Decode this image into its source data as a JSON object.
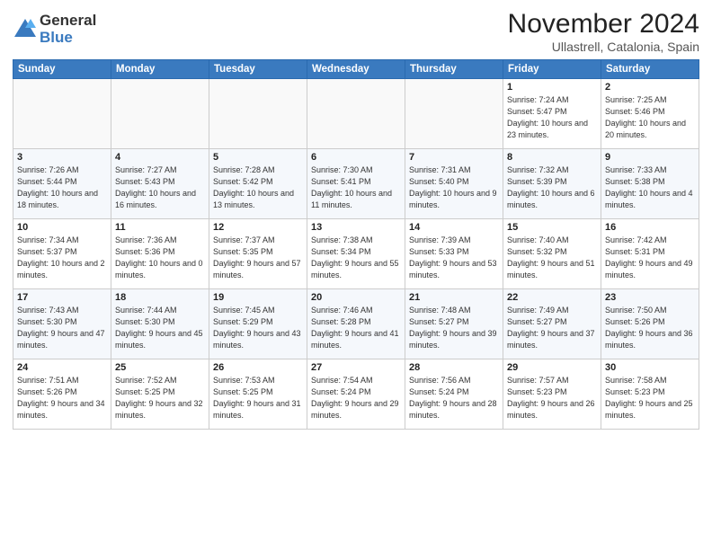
{
  "logo": {
    "general": "General",
    "blue": "Blue"
  },
  "title": "November 2024",
  "location": "Ullastrell, Catalonia, Spain",
  "weekdays": [
    "Sunday",
    "Monday",
    "Tuesday",
    "Wednesday",
    "Thursday",
    "Friday",
    "Saturday"
  ],
  "weeks": [
    [
      {
        "day": "",
        "info": ""
      },
      {
        "day": "",
        "info": ""
      },
      {
        "day": "",
        "info": ""
      },
      {
        "day": "",
        "info": ""
      },
      {
        "day": "",
        "info": ""
      },
      {
        "day": "1",
        "info": "Sunrise: 7:24 AM\nSunset: 5:47 PM\nDaylight: 10 hours\nand 23 minutes."
      },
      {
        "day": "2",
        "info": "Sunrise: 7:25 AM\nSunset: 5:46 PM\nDaylight: 10 hours\nand 20 minutes."
      }
    ],
    [
      {
        "day": "3",
        "info": "Sunrise: 7:26 AM\nSunset: 5:44 PM\nDaylight: 10 hours\nand 18 minutes."
      },
      {
        "day": "4",
        "info": "Sunrise: 7:27 AM\nSunset: 5:43 PM\nDaylight: 10 hours\nand 16 minutes."
      },
      {
        "day": "5",
        "info": "Sunrise: 7:28 AM\nSunset: 5:42 PM\nDaylight: 10 hours\nand 13 minutes."
      },
      {
        "day": "6",
        "info": "Sunrise: 7:30 AM\nSunset: 5:41 PM\nDaylight: 10 hours\nand 11 minutes."
      },
      {
        "day": "7",
        "info": "Sunrise: 7:31 AM\nSunset: 5:40 PM\nDaylight: 10 hours\nand 9 minutes."
      },
      {
        "day": "8",
        "info": "Sunrise: 7:32 AM\nSunset: 5:39 PM\nDaylight: 10 hours\nand 6 minutes."
      },
      {
        "day": "9",
        "info": "Sunrise: 7:33 AM\nSunset: 5:38 PM\nDaylight: 10 hours\nand 4 minutes."
      }
    ],
    [
      {
        "day": "10",
        "info": "Sunrise: 7:34 AM\nSunset: 5:37 PM\nDaylight: 10 hours\nand 2 minutes."
      },
      {
        "day": "11",
        "info": "Sunrise: 7:36 AM\nSunset: 5:36 PM\nDaylight: 10 hours\nand 0 minutes."
      },
      {
        "day": "12",
        "info": "Sunrise: 7:37 AM\nSunset: 5:35 PM\nDaylight: 9 hours\nand 57 minutes."
      },
      {
        "day": "13",
        "info": "Sunrise: 7:38 AM\nSunset: 5:34 PM\nDaylight: 9 hours\nand 55 minutes."
      },
      {
        "day": "14",
        "info": "Sunrise: 7:39 AM\nSunset: 5:33 PM\nDaylight: 9 hours\nand 53 minutes."
      },
      {
        "day": "15",
        "info": "Sunrise: 7:40 AM\nSunset: 5:32 PM\nDaylight: 9 hours\nand 51 minutes."
      },
      {
        "day": "16",
        "info": "Sunrise: 7:42 AM\nSunset: 5:31 PM\nDaylight: 9 hours\nand 49 minutes."
      }
    ],
    [
      {
        "day": "17",
        "info": "Sunrise: 7:43 AM\nSunset: 5:30 PM\nDaylight: 9 hours\nand 47 minutes."
      },
      {
        "day": "18",
        "info": "Sunrise: 7:44 AM\nSunset: 5:30 PM\nDaylight: 9 hours\nand 45 minutes."
      },
      {
        "day": "19",
        "info": "Sunrise: 7:45 AM\nSunset: 5:29 PM\nDaylight: 9 hours\nand 43 minutes."
      },
      {
        "day": "20",
        "info": "Sunrise: 7:46 AM\nSunset: 5:28 PM\nDaylight: 9 hours\nand 41 minutes."
      },
      {
        "day": "21",
        "info": "Sunrise: 7:48 AM\nSunset: 5:27 PM\nDaylight: 9 hours\nand 39 minutes."
      },
      {
        "day": "22",
        "info": "Sunrise: 7:49 AM\nSunset: 5:27 PM\nDaylight: 9 hours\nand 37 minutes."
      },
      {
        "day": "23",
        "info": "Sunrise: 7:50 AM\nSunset: 5:26 PM\nDaylight: 9 hours\nand 36 minutes."
      }
    ],
    [
      {
        "day": "24",
        "info": "Sunrise: 7:51 AM\nSunset: 5:26 PM\nDaylight: 9 hours\nand 34 minutes."
      },
      {
        "day": "25",
        "info": "Sunrise: 7:52 AM\nSunset: 5:25 PM\nDaylight: 9 hours\nand 32 minutes."
      },
      {
        "day": "26",
        "info": "Sunrise: 7:53 AM\nSunset: 5:25 PM\nDaylight: 9 hours\nand 31 minutes."
      },
      {
        "day": "27",
        "info": "Sunrise: 7:54 AM\nSunset: 5:24 PM\nDaylight: 9 hours\nand 29 minutes."
      },
      {
        "day": "28",
        "info": "Sunrise: 7:56 AM\nSunset: 5:24 PM\nDaylight: 9 hours\nand 28 minutes."
      },
      {
        "day": "29",
        "info": "Sunrise: 7:57 AM\nSunset: 5:23 PM\nDaylight: 9 hours\nand 26 minutes."
      },
      {
        "day": "30",
        "info": "Sunrise: 7:58 AM\nSunset: 5:23 PM\nDaylight: 9 hours\nand 25 minutes."
      }
    ]
  ]
}
